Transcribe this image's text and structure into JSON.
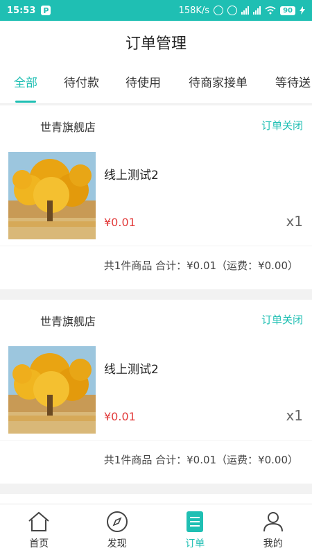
{
  "status_bar": {
    "time": "15:53",
    "net_speed": "158K/s",
    "battery": "90",
    "icons": [
      "p-badge-icon",
      "mute-icon",
      "alarm-icon",
      "signal-icon",
      "wifi-icon",
      "battery-icon",
      "charging-icon"
    ]
  },
  "header": {
    "title": "订单管理"
  },
  "tabs": [
    {
      "label": "全部",
      "active": true
    },
    {
      "label": "待付款"
    },
    {
      "label": "待使用"
    },
    {
      "label": "待商家接单"
    },
    {
      "label": "等待送"
    }
  ],
  "orders": [
    {
      "store": "世青旗舰店",
      "status": "订单关闭",
      "product_name": "线上测试2",
      "price": "¥0.01",
      "quantity": "x1",
      "summary": "共1件商品 合计：¥0.01（运费：¥0.00）",
      "thumb_icon": "tree-photo"
    },
    {
      "store": "世青旗舰店",
      "status": "订单关闭",
      "product_name": "线上测试2",
      "price": "¥0.01",
      "quantity": "x1",
      "summary": "共1件商品 合计：¥0.01（运费：¥0.00）",
      "thumb_icon": "tree-photo"
    }
  ],
  "bottom_nav": [
    {
      "label": "首页",
      "icon": "home-icon"
    },
    {
      "label": "发现",
      "icon": "compass-icon"
    },
    {
      "label": "订单",
      "icon": "order-icon",
      "active": true
    },
    {
      "label": "我的",
      "icon": "user-icon"
    }
  ],
  "colors": {
    "accent": "#1fbfb3",
    "price": "#e23a3a"
  }
}
